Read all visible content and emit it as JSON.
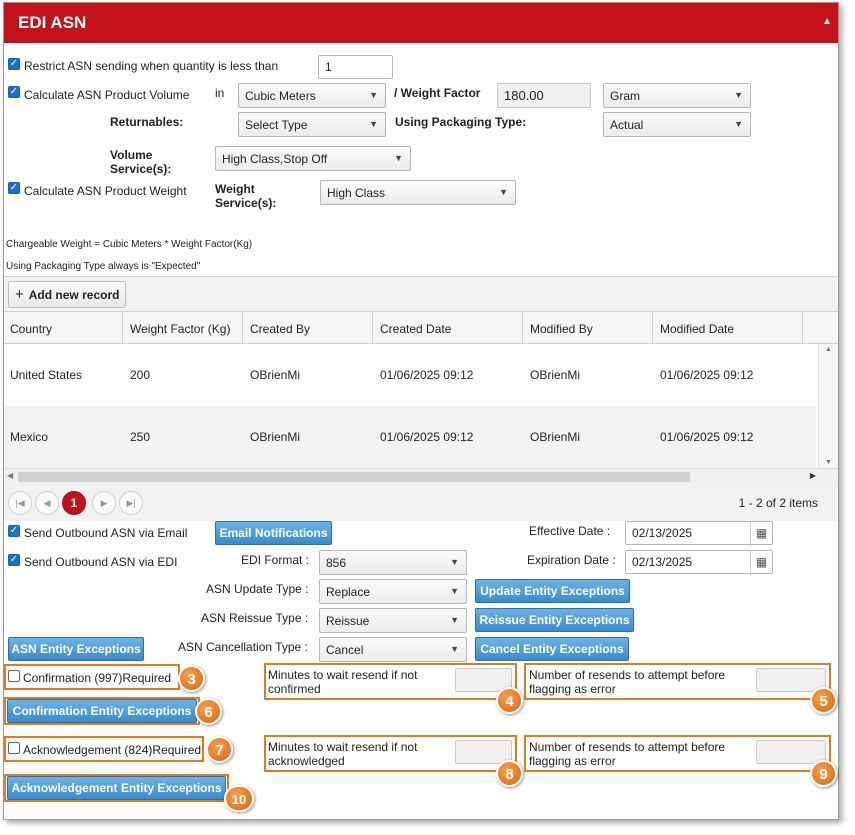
{
  "header": {
    "title": "EDI ASN"
  },
  "settings": {
    "restrict_label": "Restrict ASN sending when quantity is less than",
    "restrict_value": "1",
    "volume_label": "Calculate ASN Product Volume",
    "in_label": "in",
    "volume_unit": "Cubic Meters",
    "weight_factor_label": "/ Weight Factor",
    "weight_factor_value": "180.00",
    "weight_unit": "Gram",
    "returnables_label": "Returnables:",
    "returnables_value": "Select Type",
    "packaging_label": "Using Packaging Type:",
    "packaging_value": "Actual",
    "volume_services_label_1": "Volume",
    "volume_services_label_2": "Service(s):",
    "volume_services_value": "High Class,Stop Off",
    "weight_label": "Calculate ASN Product Weight",
    "weight_services_label_1": "Weight",
    "weight_services_label_2": "Service(s):",
    "weight_services_value": "High Class",
    "note_1": "Chargeable Weight = Cubic Meters * Weight Factor(Kg)",
    "note_2": "Using Packaging Type always is \"Expected\""
  },
  "grid": {
    "add_label": "Add new record",
    "columns": [
      "Country",
      "Weight Factor (Kg)",
      "Created By",
      "Created Date",
      "Modified By",
      "Modified Date"
    ],
    "rows": [
      [
        "United States",
        "200",
        "OBrienMi",
        "01/06/2025 09:12",
        "OBrienMi",
        "01/06/2025 09:12"
      ],
      [
        "Mexico",
        "250",
        "OBrienMi",
        "01/06/2025 09:12",
        "OBrienMi",
        "01/06/2025 09:12"
      ]
    ],
    "current_page": "1",
    "items_info": "1 - 2 of 2 items"
  },
  "outbound": {
    "email_label": "Send Outbound ASN via Email",
    "email_notifications_btn": "Email Notifications",
    "edi_label": "Send Outbound ASN via EDI",
    "effective_label": "Effective Date :",
    "effective_value": "02/13/2025",
    "expiration_label": "Expiration Date :",
    "expiration_value": "02/13/2025",
    "edi_format_label": "EDI Format :",
    "edi_format_value": "856",
    "update_label": "ASN Update Type :",
    "update_value": "Replace",
    "update_btn": "Update Entity Exceptions",
    "reissue_label": "ASN Reissue Type :",
    "reissue_value": "Reissue",
    "reissue_btn": "Reissue Entity Exceptions",
    "cancel_label": "ASN Cancellation Type :",
    "cancel_value": "Cancel",
    "cancel_btn": "Cancel Entity Exceptions",
    "asn_exceptions_btn": "ASN Entity Exceptions"
  },
  "confirmation": {
    "label": "Confirmation (997)Required",
    "exceptions_btn": "Confirmation Entity Exceptions",
    "minutes_label_1": "Minutes to wait resend if not",
    "minutes_label_2": "confirmed",
    "resends_label_1": "Number of resends to attempt before",
    "resends_label_2": "flagging as error"
  },
  "acknowledgement": {
    "label": "Acknowledgement (824)Required",
    "exceptions_btn": "Acknowledgement Entity Exceptions",
    "minutes_label_1": "Minutes to wait resend if not",
    "minutes_label_2": "acknowledged",
    "resends_label_1": "Number of resends to attempt before",
    "resends_label_2": "flagging as error"
  },
  "callouts": [
    "3",
    "4",
    "5",
    "6",
    "7",
    "8",
    "9",
    "10"
  ],
  "colors": {
    "header": "#c4121b",
    "button": "#3a8bcd",
    "callout": "#e07a1f"
  }
}
